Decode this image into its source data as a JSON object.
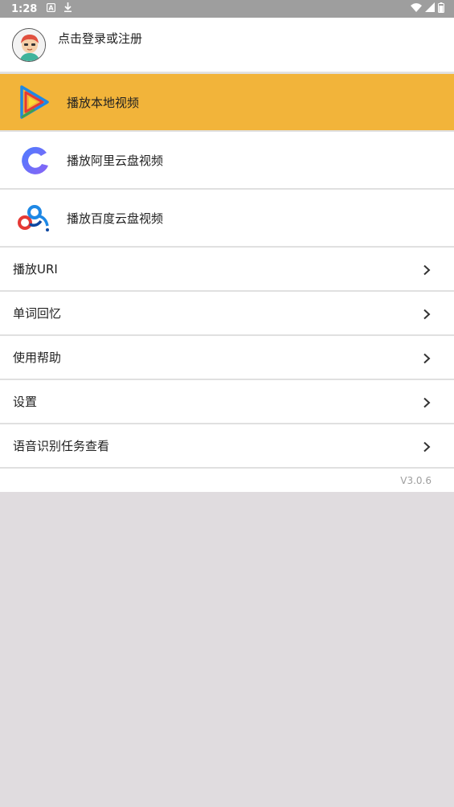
{
  "status_bar": {
    "time": "1:28"
  },
  "login": {
    "text": "点击登录或注册"
  },
  "play_items": [
    {
      "label": "播放本地视频",
      "active": true,
      "icon": "play-local-icon"
    },
    {
      "label": "播放阿里云盘视频",
      "active": false,
      "icon": "aliyun-drive-icon"
    },
    {
      "label": "播放百度云盘视频",
      "active": false,
      "icon": "baidu-drive-icon"
    }
  ],
  "menu_items": [
    {
      "label": "播放URI"
    },
    {
      "label": "单词回忆"
    },
    {
      "label": "使用帮助"
    },
    {
      "label": "设置"
    },
    {
      "label": "语音识别任务查看"
    }
  ],
  "version": "V3.0.6",
  "colors": {
    "accent": "#f2b43a",
    "status_bar": "#9e9e9e",
    "background": "#e0dcdf"
  }
}
